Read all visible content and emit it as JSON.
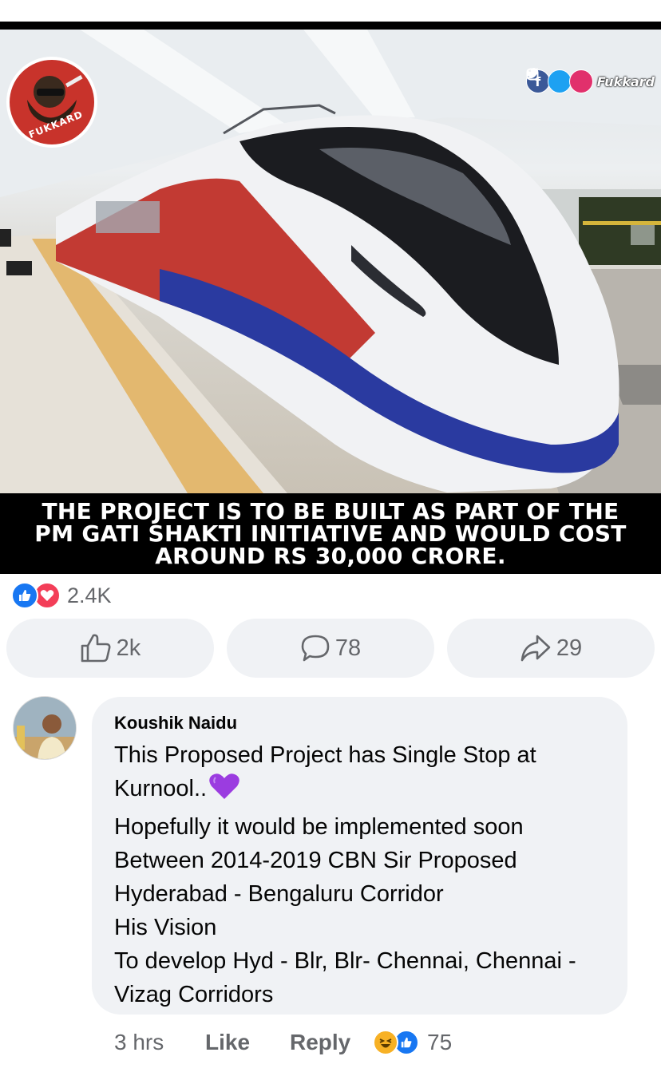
{
  "post": {
    "logo_text": "FUKKARD",
    "social_handle": "Fukkard",
    "caption": "THE PROJECT IS TO BE BUILT AS PART OF THE PM GATI SHAKTI INITIATIVE AND WOULD COST AROUND RS 30,000 CRORE.",
    "reaction_count": "2.4K"
  },
  "actions": {
    "like_count": "2k",
    "comment_count": "78",
    "share_count": "29"
  },
  "comment": {
    "author": "Koushik Naidu",
    "lines": [
      "This Proposed Project has Single Stop at",
      "Kurnool..",
      "Hopefully it would be implemented soon",
      "Between 2014-2019 CBN Sir Proposed",
      "Hyderabad - Bengaluru Corridor",
      "His Vision",
      "To develop Hyd - Blr, Blr- Chennai, Chennai -",
      "Vizag Corridors"
    ],
    "time": "3 hrs",
    "like_label": "Like",
    "reply_label": "Reply",
    "reaction_count": "75"
  },
  "colors": {
    "facebook_blue": "#1877f2",
    "love_red": "#f33e58",
    "heart_purple": "#9b3ce0",
    "muted_text": "#65676b",
    "bubble_bg": "#f0f2f5"
  },
  "icons": [
    "facebook-icon",
    "twitter-icon",
    "instagram-icon",
    "like-reaction-icon",
    "love-reaction-icon",
    "thumbs-up-icon",
    "comment-icon",
    "share-arrow-icon",
    "purple-heart-emoji",
    "haha-reaction-icon"
  ]
}
